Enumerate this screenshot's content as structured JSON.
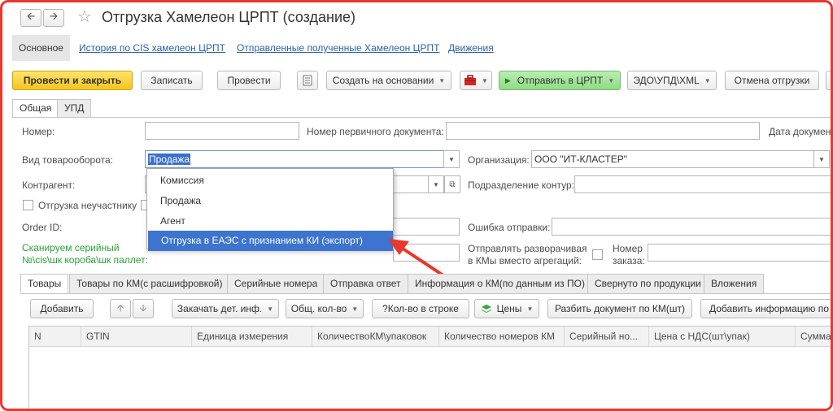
{
  "window": {
    "title": "Отгрузка Хамелеон ЦРПТ (создание)",
    "back_icon": "arrow-left-icon",
    "forward_icon": "arrow-right-icon",
    "favorite_icon": "star-icon"
  },
  "top_tabs": [
    {
      "label": "Основное",
      "active": true
    },
    {
      "label": "История по CIS хамелеон ЦРПТ"
    },
    {
      "label": "Отправленные полученные Хамелеон ЦРПТ"
    },
    {
      "label": "Движения"
    }
  ],
  "toolbar": {
    "post_close": "Провести и закрыть",
    "save": "Записать",
    "post": "Провести",
    "create_based": "Создать на основании",
    "send_crpt": "Отправить в ЦРПТ",
    "edo": "ЭДО\\УПД\\XML",
    "cancel_shipment": "Отмена отгрузки"
  },
  "form_tabs": [
    {
      "label": "Общая",
      "active": true
    },
    {
      "label": "УПД"
    }
  ],
  "form": {
    "number_label": "Номер:",
    "number_value": "",
    "primary_doc_label": "Номер первичного документа:",
    "primary_doc_value": "",
    "doc_date_label": "Дата документ",
    "turnover_label": "Вид товарооборота:",
    "turnover_value": "Продажа",
    "org_label": "Организация:",
    "org_value": "ООО \"ИТ-КЛАСТЕР\"",
    "counterparty_label": "Контрагент:",
    "subdivision_label": "Подразделение контур:",
    "non_participant_label": "Отгрузка неучастнику",
    "order_id_label": "Order ID:",
    "send_error_label": "Ошибка отправки:",
    "scan_label_line1": "Сканируем серийный",
    "scan_label_line2": "№\\cis\\шк короба\\шк паллет:",
    "unpack_label_line1": "Отправлять разворачивая",
    "unpack_label_line2": "в КМы вместо агрегаций:",
    "order_no_label_line1": "Номер",
    "order_no_label_line2": "заказа:"
  },
  "dropdown": {
    "items": [
      {
        "label": "Комиссия"
      },
      {
        "label": "Продажа"
      },
      {
        "label": "Агент"
      },
      {
        "label": "Отгрузка в ЕАЭС с признанием КИ (экспорт)",
        "selected": true
      }
    ]
  },
  "bottom_tabs": [
    {
      "label": "Товары",
      "active": true
    },
    {
      "label": "Товары по КМ(с расшифровкой)"
    },
    {
      "label": "Серийные номера"
    },
    {
      "label": "Отправка ответ"
    },
    {
      "label": "Информация о КМ(по данным из ПО)"
    },
    {
      "label": "Свернуто по продукции"
    },
    {
      "label": "Вложения"
    }
  ],
  "table_toolbar": {
    "add": "Добавить",
    "load_details": "Закачать дет. инф.",
    "total_qty": "Общ. кол-во",
    "qty_in_row": "?Кол-во в строке",
    "prices": "Цены",
    "split_doc": "Разбить документ по КМ(шт)",
    "add_info": "Добавить информацию по т"
  },
  "table": {
    "columns": [
      "N",
      "GTIN",
      "Единица измерения",
      "КоличествоКМ\\упаковок",
      "Количество номеров КМ",
      "Серийный но...",
      "Цена с НДС(шт\\упак)",
      "Сумма Н"
    ]
  },
  "colors": {
    "frame": "#e8382e",
    "primary_button": "#f5c520",
    "send_button": "#8fdc85",
    "selection": "#3d74cf",
    "link": "#2962b0",
    "green_text": "#2aa235"
  }
}
